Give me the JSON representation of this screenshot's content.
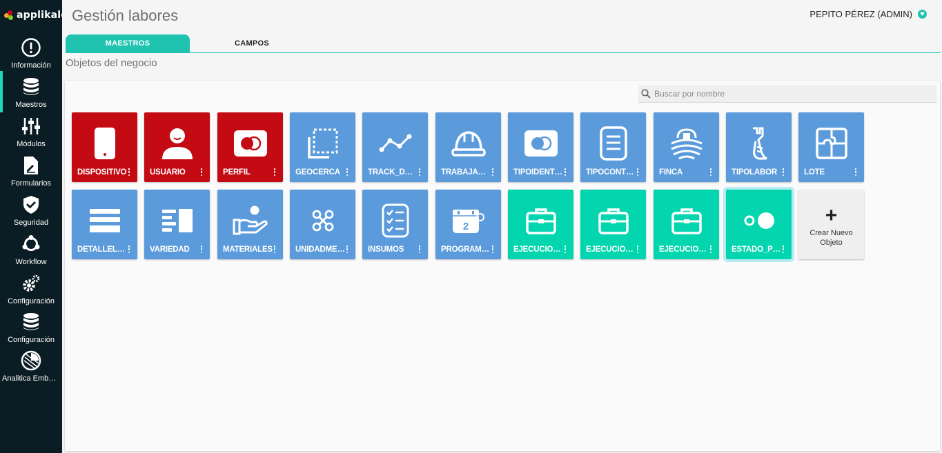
{
  "brand": {
    "name": "applikalo"
  },
  "sidebar": {
    "items": [
      {
        "label": "Información",
        "icon": "info-icon",
        "active": false
      },
      {
        "label": "Maestros",
        "icon": "database-icon",
        "active": true
      },
      {
        "label": "Módulos",
        "icon": "sliders-icon",
        "active": false
      },
      {
        "label": "Formularios",
        "icon": "form-edit-icon",
        "active": false
      },
      {
        "label": "Seguridad",
        "icon": "shield-icon",
        "active": false
      },
      {
        "label": "Workflow",
        "icon": "workflow-icon",
        "active": false
      },
      {
        "label": "Configuración",
        "icon": "gears-icon",
        "active": false
      },
      {
        "label": "Configuración",
        "icon": "database-icon",
        "active": false
      },
      {
        "label": "Analitica Embebida",
        "icon": "pie-chart-icon",
        "active": false
      }
    ]
  },
  "header": {
    "title": "Gestión labores",
    "user": "PEPITO PÉREZ",
    "role": "(ADMIN)"
  },
  "tabs": [
    {
      "label": "MAESTROS",
      "active": true
    },
    {
      "label": "CAMPOS",
      "active": false
    }
  ],
  "section_title": "Objetos del negocio",
  "search": {
    "placeholder": "Buscar por nombre",
    "value": ""
  },
  "colors": {
    "red": "#c40b14",
    "blue": "#5b9bdb",
    "teal": "#03d6ae",
    "accent": "#1fc3b0",
    "sidebar": "#0b1d24"
  },
  "objects": [
    {
      "label": "DISPOSITIVO",
      "color": "red",
      "icon": "phone-icon"
    },
    {
      "label": "USUARIO",
      "color": "red",
      "icon": "user-icon"
    },
    {
      "label": "PERFIL",
      "color": "red",
      "icon": "profile-card-icon"
    },
    {
      "label": "GEOCERCA",
      "color": "blue",
      "icon": "geofence-icon"
    },
    {
      "label": "TRACK_DEVICE",
      "color": "blue",
      "icon": "trend-line-icon"
    },
    {
      "label": "TRABAJADOR",
      "color": "blue",
      "icon": "hard-hat-icon"
    },
    {
      "label": "TIPOIDENTIFICACION",
      "color": "blue",
      "icon": "id-card-icon"
    },
    {
      "label": "TIPOCONTRATO",
      "color": "blue",
      "icon": "document-icon"
    },
    {
      "label": "FINCA",
      "color": "blue",
      "icon": "farm-icon"
    },
    {
      "label": "TIPOLABOR",
      "color": "blue",
      "icon": "wrench-hand-icon"
    },
    {
      "label": "LOTE",
      "color": "blue",
      "icon": "puzzle-icon"
    },
    {
      "label": "DETALLELOTE",
      "color": "blue",
      "icon": "rows-icon"
    },
    {
      "label": "VARIEDAD",
      "color": "blue",
      "icon": "list-panel-icon"
    },
    {
      "label": "MATERIALES",
      "color": "blue",
      "icon": "hand-give-icon"
    },
    {
      "label": "UNIDADMEDIDA",
      "color": "blue",
      "icon": "measure-icon"
    },
    {
      "label": "INSUMOS",
      "color": "blue",
      "icon": "checklist-icon"
    },
    {
      "label": "PROGRAMACION",
      "color": "blue",
      "icon": "calendar-icon"
    },
    {
      "label": "EJECUCIONLABOR",
      "color": "teal",
      "icon": "briefcase-icon"
    },
    {
      "label": "EJECUCIONINSUMO",
      "color": "teal",
      "icon": "briefcase-icon"
    },
    {
      "label": "EJECUCIONMATERIAL",
      "color": "teal",
      "icon": "briefcase-icon"
    },
    {
      "label": "ESTADO_PROGRAMACION",
      "color": "teal",
      "icon": "toggle-dots-icon",
      "selected": true
    }
  ],
  "new_object": {
    "plus": "+",
    "label": "Crear Nuevo Objeto"
  }
}
